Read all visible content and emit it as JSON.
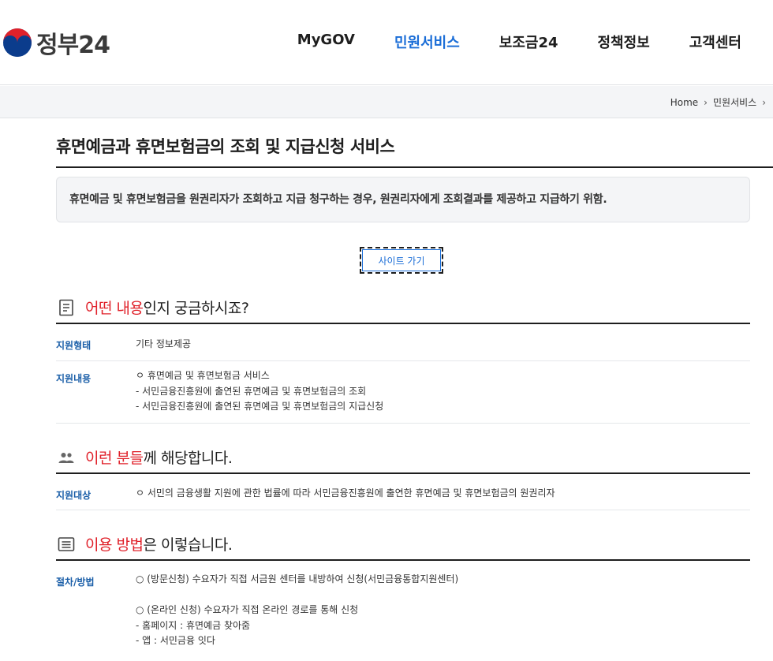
{
  "header": {
    "logo_text": "정부24",
    "nav": [
      "MyGOV",
      "민원서비스",
      "보조금24",
      "정책정보",
      "고객센터"
    ],
    "active_nav": "민원서비스"
  },
  "breadcrumb": [
    "Home",
    "민원서비스"
  ],
  "page_title": "휴면예금과 휴면보험금의 조회 및 지급신청 서비스",
  "summary": "휴면예금 및 휴면보험금을 원권리자가 조회하고 지급 청구하는 경우, 원권리자에게 조회결과를 제공하고 지급하기 위함.",
  "site_button": "사이트 가기",
  "sections": {
    "what": {
      "title_highlight": "어떤 내용",
      "title_rest": "인지 궁금하시죠?",
      "rows": [
        {
          "label": "지원형태",
          "lines": [
            "기타  정보제공"
          ]
        },
        {
          "label": "지원내용",
          "lines": [
            "ㅇ 휴면예금 및 휴면보험금 서비스",
            " - 서민금융진흥원에 출연된 휴면예금 및 휴면보험금의 조회",
            " - 서민금융진흥원에 출연된 휴면예금 및 휴면보험금의 지급신청"
          ]
        }
      ]
    },
    "who": {
      "title_highlight": "이런 분들",
      "title_rest": "께 해당합니다.",
      "rows": [
        {
          "label": "지원대상",
          "lines": [
            "ㅇ 서민의 금융생활 지원에 관한 법률에 따라 서민금융진흥원에 출연한 휴면예금 및 휴면보험금의 원권리자"
          ]
        }
      ]
    },
    "how": {
      "title_highlight": "이용 방법",
      "title_rest": "은 이렇습니다.",
      "rows": [
        {
          "label": "절차/방법",
          "lines": [
            "○ (방문신청) 수요자가 직접 서금원 센터를 내방하여 신청(서민금융통합지원센터)",
            "",
            "○ (온라인 신청) 수요자가 직접 온라인 경로를 통해 신청",
            "- 홈페이지 : 휴면예금 찾아줌",
            "- 앱 : 서민금융 잇다"
          ]
        }
      ]
    }
  },
  "colors": {
    "accent": "#1a6dd7",
    "highlight": "#e0212a",
    "label": "#1a5ea8"
  },
  "icons": [
    "government-logo-icon",
    "document-icon",
    "people-icon",
    "list-icon",
    "chevron-right-icon"
  ]
}
